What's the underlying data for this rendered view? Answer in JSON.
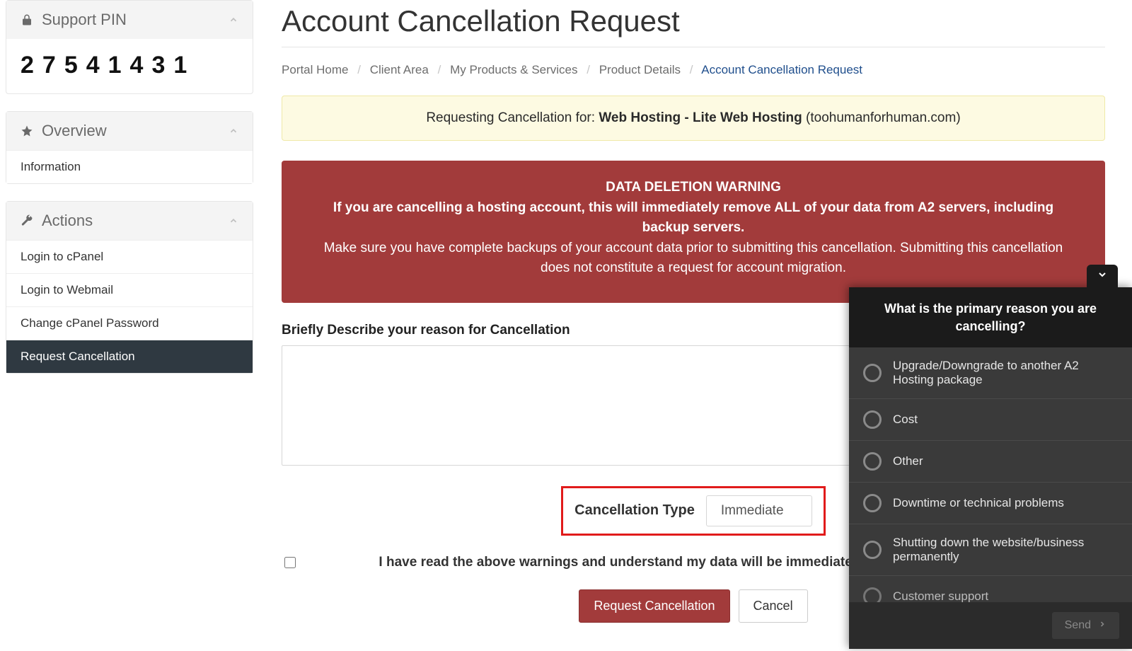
{
  "sidebar": {
    "support_pin": {
      "title": "Support PIN",
      "value": "27541431"
    },
    "overview": {
      "title": "Overview",
      "items": [
        "Information"
      ]
    },
    "actions": {
      "title": "Actions",
      "items": [
        {
          "label": "Login to cPanel",
          "active": false
        },
        {
          "label": "Login to Webmail",
          "active": false
        },
        {
          "label": "Change cPanel Password",
          "active": false
        },
        {
          "label": "Request Cancellation",
          "active": true
        }
      ]
    }
  },
  "page": {
    "title": "Account Cancellation Request",
    "breadcrumb": [
      "Portal Home",
      "Client Area",
      "My Products & Services",
      "Product Details",
      "Account Cancellation Request"
    ]
  },
  "alerts": {
    "requesting_prefix": "Requesting Cancellation for: ",
    "requesting_product": "Web Hosting - Lite Web Hosting",
    "requesting_domain": " (toohumanforhuman.com)",
    "warning_title": "DATA DELETION WARNING",
    "warning_line1": "If you are cancelling a hosting account, this will immediately remove ALL of your data from A2 servers, including backup servers.",
    "warning_line2": "Make sure you have complete backups of your account data prior to submitting this cancellation. Submitting this cancellation does not constitute a request for account migration."
  },
  "form": {
    "reason_label": "Briefly Describe your reason for Cancellation",
    "reason_value": "",
    "ctype_label": "Cancellation Type",
    "ctype_value": "Immediate",
    "consent_text": "I have read the above warnings and understand my data will be immediately deleted upon cancellation.",
    "submit_label": "Request Cancellation",
    "cancel_label": "Cancel"
  },
  "survey": {
    "header": "What is the primary reason you are cancelling?",
    "options": [
      "Upgrade/Downgrade to another A2 Hosting package",
      "Cost",
      "Other",
      "Downtime or technical problems",
      "Shutting down the website/business permanently",
      "Customer support"
    ],
    "send_label": "Send"
  }
}
